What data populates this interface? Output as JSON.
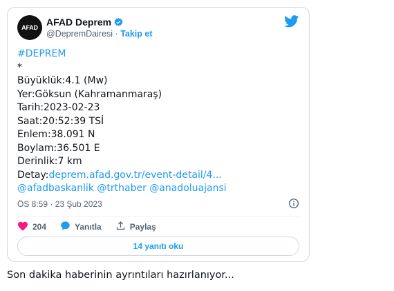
{
  "tweet": {
    "avatar_text": "AFAD",
    "display_name": "AFAD Deprem",
    "handle": "@DepremDairesi",
    "separator": "·",
    "follow_label": "Takip et",
    "lines": {
      "hashtag": "#DEPREM",
      "star": "*",
      "magnitude": "Büyüklük:4.1 (Mw)",
      "location": "Yer:Göksun (Kahramanmaraş)",
      "date": "Tarih:2023-02-23",
      "time": "Saat:20:52:39 TSİ",
      "latitude": "Enlem:38.091 N",
      "longitude": "Boylam:36.501 E",
      "depth": "Derinlik:7 km",
      "detail_label": "Detay:",
      "detail_link": "deprem.afad.gov.tr/event-detail/4...",
      "mentions": "@afadbaskanlik @trthaber @anadoluajansi"
    },
    "timestamp": "ÖS 8:59 · 23 Şub 2023",
    "likes_count": "204",
    "reply_label": "Yanıtla",
    "share_label": "Paylaş",
    "read_replies_label": "14 yanıtı oku",
    "colors": {
      "accent": "#1d9bf0",
      "like": "#f91880",
      "muted": "#536471"
    }
  },
  "footer": {
    "status_text": "Son dakika haberinin ayrıntıları hazırlanıyor..."
  }
}
